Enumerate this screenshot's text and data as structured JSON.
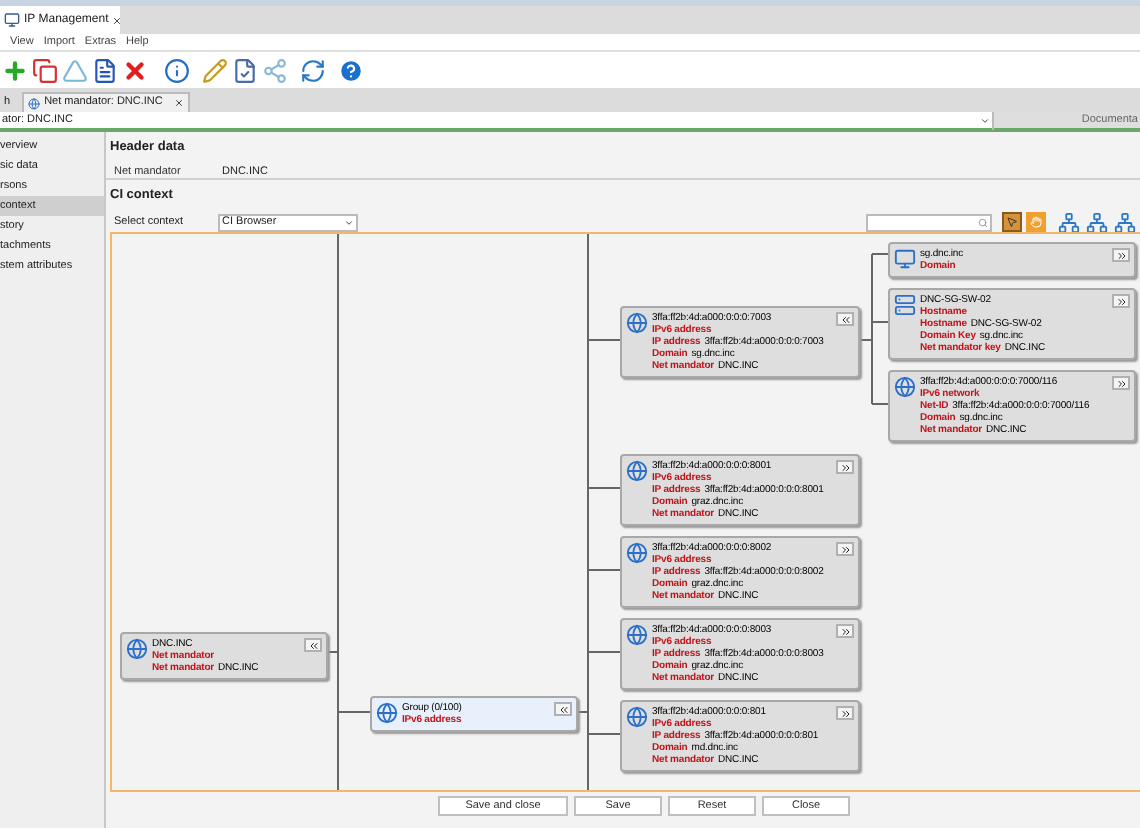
{
  "app_tab": {
    "title": "IP Management"
  },
  "menu": [
    "View",
    "Import",
    "Extras",
    "Help"
  ],
  "doc_tabs": [
    {
      "label": "h",
      "selected": false
    },
    {
      "label": "Net mandator: DNC.INC",
      "selected": true
    }
  ],
  "mandator_bar": {
    "label": "ator: DNC.INC",
    "documents_label": "Documenta"
  },
  "sidebar": {
    "items": [
      {
        "label": "verview",
        "selected": false
      },
      {
        "label": "sic data",
        "selected": false
      },
      {
        "label": "rsons",
        "selected": false
      },
      {
        "label": "context",
        "selected": true
      },
      {
        "label": "story",
        "selected": false
      },
      {
        "label": "tachments",
        "selected": false
      },
      {
        "label": "stem attributes",
        "selected": false
      }
    ]
  },
  "header_data": {
    "title": "Header data",
    "fields": [
      {
        "label": "Net mandator",
        "value": "DNC.INC"
      }
    ]
  },
  "ci_context": {
    "title": "CI context",
    "select_label": "Select context",
    "select_value": "CI Browser",
    "nodes": [
      {
        "kind": "mandator",
        "title": "DNC.INC",
        "type": "Net mandator",
        "expanded": true,
        "selected": false,
        "fields": [
          {
            "label": "Net mandator",
            "value": "DNC.INC"
          }
        ]
      },
      {
        "kind": "network",
        "title": "Group (0/100)",
        "type": "IPv6 address",
        "expanded": true,
        "selected": true
      },
      {
        "kind": "network",
        "title": "3ffa:ff2b:4d:a000:0:0:0:7003",
        "type": "IPv6 address",
        "expanded": true,
        "selected": false,
        "fields": [
          {
            "label": "IP address",
            "value": "3ffa:ff2b:4d:a000:0:0:0:7003"
          },
          {
            "label": "Domain",
            "value": "sg.dnc.inc"
          },
          {
            "label": "Net mandator",
            "value": "DNC.INC"
          }
        ]
      },
      {
        "kind": "domain",
        "title": "sg.dnc.inc",
        "type": "Domain",
        "expanded": false,
        "selected": false
      },
      {
        "kind": "host",
        "title": "DNC-SG-SW-02",
        "type": "Hostname",
        "expanded": false,
        "selected": false,
        "fields": [
          {
            "label": "Hostname",
            "value": "DNC-SG-SW-02"
          },
          {
            "label": "Domain Key",
            "value": "sg.dnc.inc"
          },
          {
            "label": "Net mandator key",
            "value": "DNC.INC"
          }
        ]
      },
      {
        "kind": "network",
        "title": "3ffa:ff2b:4d:a000:0:0:0:7000/116",
        "type": "IPv6 network",
        "expanded": false,
        "selected": false,
        "fields": [
          {
            "label": "Net-ID",
            "value": "3ffa:ff2b:4d:a000:0:0:0:7000/116"
          },
          {
            "label": "Domain",
            "value": "sg.dnc.inc"
          },
          {
            "label": "Net mandator",
            "value": "DNC.INC"
          }
        ]
      },
      {
        "kind": "network",
        "title": "3ffa:ff2b:4d:a000:0:0:0:8001",
        "type": "IPv6 address",
        "expanded": false,
        "selected": false,
        "fields": [
          {
            "label": "IP address",
            "value": "3ffa:ff2b:4d:a000:0:0:0:8001"
          },
          {
            "label": "Domain",
            "value": "graz.dnc.inc"
          },
          {
            "label": "Net mandator",
            "value": "DNC.INC"
          }
        ]
      },
      {
        "kind": "network",
        "title": "3ffa:ff2b:4d:a000:0:0:0:8002",
        "type": "IPv6 address",
        "expanded": false,
        "selected": false,
        "fields": [
          {
            "label": "IP address",
            "value": "3ffa:ff2b:4d:a000:0:0:0:8002"
          },
          {
            "label": "Domain",
            "value": "graz.dnc.inc"
          },
          {
            "label": "Net mandator",
            "value": "DNC.INC"
          }
        ]
      },
      {
        "kind": "network",
        "title": "3ffa:ff2b:4d:a000:0:0:0:8003",
        "type": "IPv6 address",
        "expanded": false,
        "selected": false,
        "fields": [
          {
            "label": "IP address",
            "value": "3ffa:ff2b:4d:a000:0:0:0:8003"
          },
          {
            "label": "Domain",
            "value": "graz.dnc.inc"
          },
          {
            "label": "Net mandator",
            "value": "DNC.INC"
          }
        ]
      },
      {
        "kind": "network",
        "title": "3ffa:ff2b:4d:a000:0:0:0:801",
        "type": "IPv6 address",
        "expanded": false,
        "selected": false,
        "fields": [
          {
            "label": "IP address",
            "value": "3ffa:ff2b:4d:a000:0:0:0:801"
          },
          {
            "label": "Domain",
            "value": "md.dnc.inc"
          },
          {
            "label": "Net mandator",
            "value": "DNC.INC"
          }
        ]
      }
    ]
  },
  "buttons": [
    "Save and close",
    "Save",
    "Reset",
    "Close"
  ]
}
